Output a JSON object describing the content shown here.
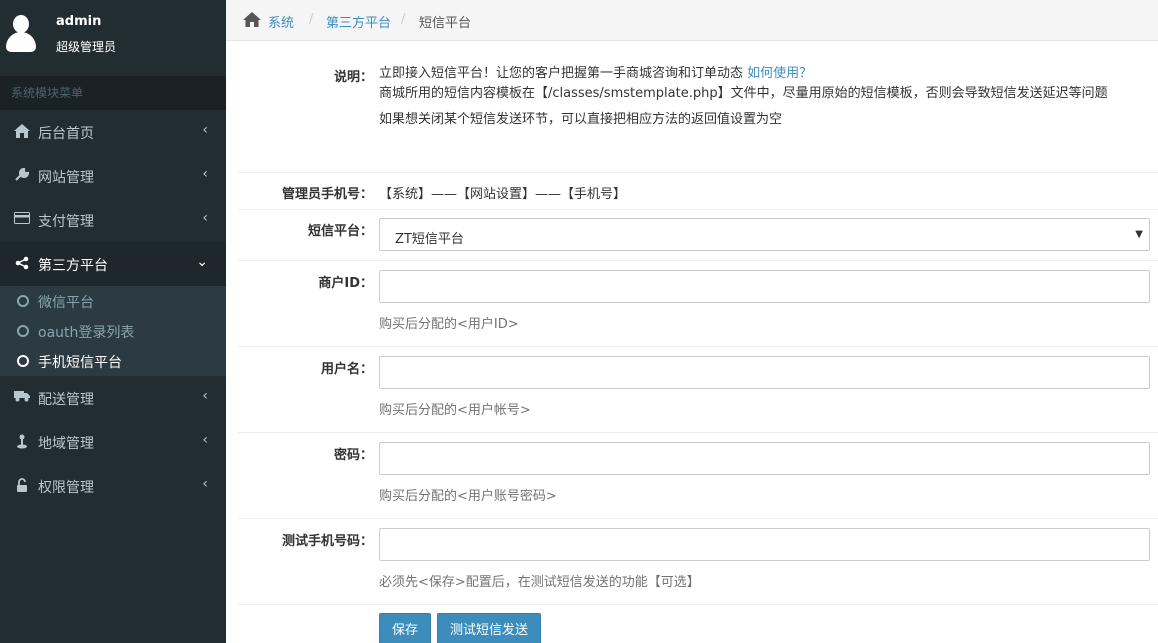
{
  "user": {
    "name": "admin",
    "role": "超级管理员"
  },
  "sidebar": {
    "header": "系统模块菜单",
    "items": [
      {
        "label": "后台首页",
        "icon": "home-icon"
      },
      {
        "label": "网站管理",
        "icon": "wrench-icon"
      },
      {
        "label": "支付管理",
        "icon": "credit-card-icon"
      },
      {
        "label": "第三方平台",
        "icon": "share-icon"
      },
      {
        "label": "配送管理",
        "icon": "truck-icon"
      },
      {
        "label": "地域管理",
        "icon": "map-pin-icon"
      },
      {
        "label": "权限管理",
        "icon": "unlock-icon"
      }
    ],
    "submenu": [
      {
        "label": "微信平台"
      },
      {
        "label": "oauth登录列表"
      },
      {
        "label": "手机短信平台"
      }
    ]
  },
  "breadcrumb": {
    "home": "系统",
    "section": "第三方平台",
    "current": "短信平台",
    "sep": "/"
  },
  "form": {
    "desc_label": "说明：",
    "desc_line1": "立即接入短信平台！让您的客户把握第一手商城咨询和订单动态",
    "desc_link": "如何使用？",
    "desc_line2": "商城所用的短信内容模板在【/classes/smstemplate.php】文件中，尽量用原始的短信模板，否则会导致短信发送延迟等问题",
    "desc_line3": "如果想关闭某个短信发送环节，可以直接把相应方法的返回值设置为空",
    "phone_label": "管理员手机号：",
    "phone_value": "【系统】——【网站设置】——【手机号】",
    "platform_label": "短信平台：",
    "platform_value": "ZT短信平台",
    "merchant_label": "商户ID：",
    "merchant_help": "购买后分配的<用户ID>",
    "username_label": "用户名：",
    "username_help": "购买后分配的<用户帐号>",
    "password_label": "密码：",
    "password_help": "购买后分配的<用户账号密码>",
    "test_label": "测试手机号码：",
    "test_help": "必须先<保存>配置后，在测试短信发送的功能【可选】",
    "save_button": "保存",
    "test_button": "测试短信发送"
  }
}
